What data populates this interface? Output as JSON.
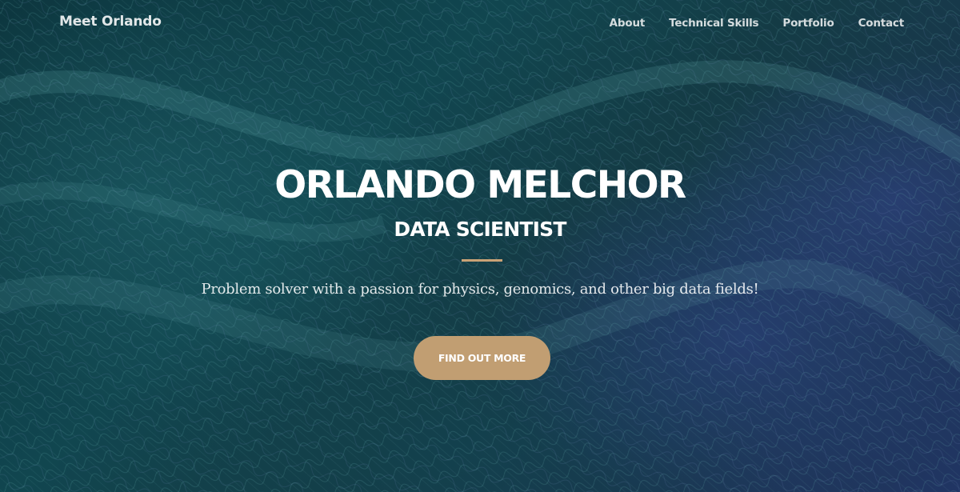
{
  "nav": {
    "brand": "Meet Orlando",
    "links": [
      {
        "label": "About"
      },
      {
        "label": "Technical Skills"
      },
      {
        "label": "Portfolio"
      },
      {
        "label": "Contact"
      }
    ]
  },
  "hero": {
    "title": "ORLANDO MELCHOR",
    "subtitle": "DATA SCIENTIST",
    "tagline": "Problem solver with a passion for physics, genomics, and other big data fields!",
    "cta_label": "FIND OUT MORE"
  },
  "colors": {
    "accent": "#c19e72",
    "background_teal": "#14505a",
    "background_blue": "#283b73"
  }
}
